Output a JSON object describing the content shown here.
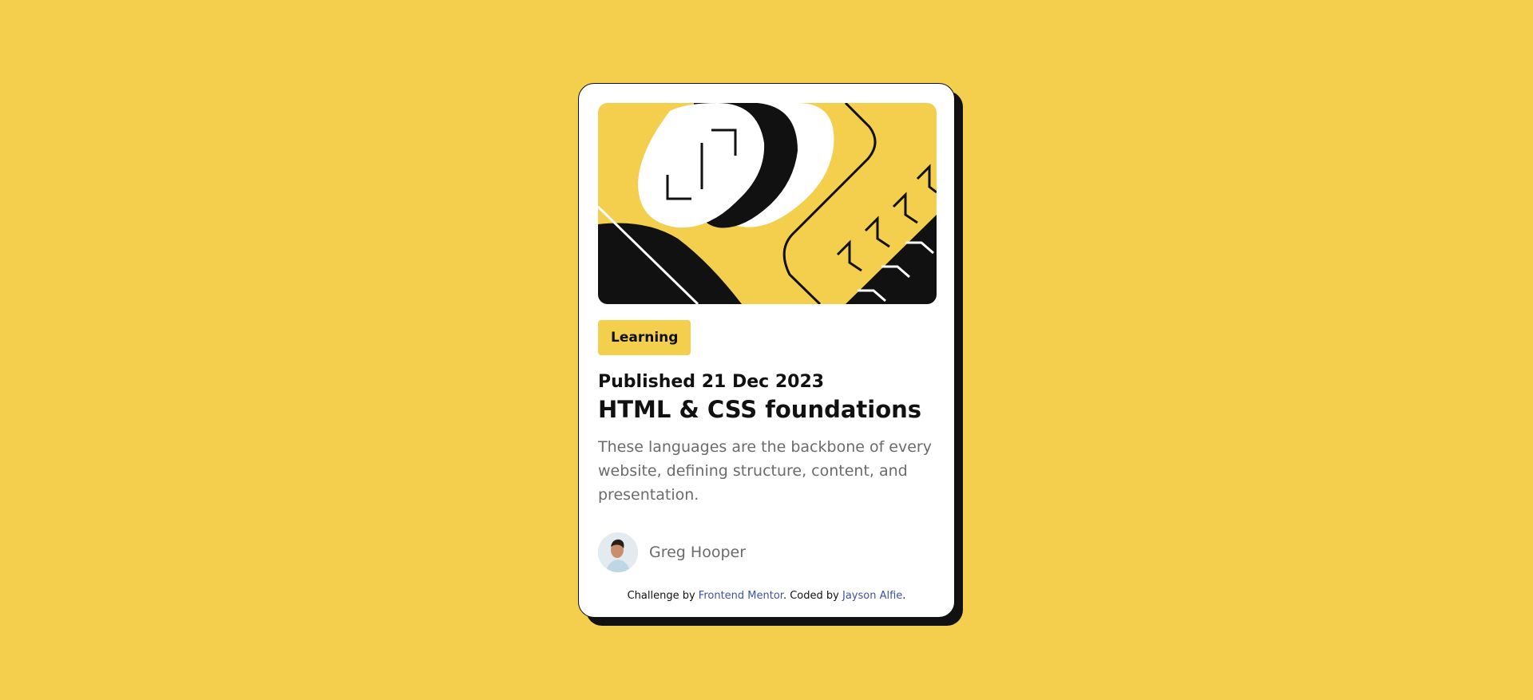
{
  "card": {
    "tag": "Learning",
    "published": "Published 21 Dec 2023",
    "title": "HTML & CSS foundations",
    "description": "These languages are the backbone of every website, defining structure, content, and presentation.",
    "author": {
      "name": "Greg Hooper"
    }
  },
  "attribution": {
    "prefix": "Challenge by",
    "frontend_mentor": "Frontend Mentor",
    "middle": ". Coded by",
    "coder": "Jayson Alfie",
    "suffix": "."
  },
  "colors": {
    "background": "#F4CF4E",
    "card": "#FFFFFF",
    "text": "#111111",
    "muted": "#6B6B6B",
    "link": "#3E52A3"
  }
}
